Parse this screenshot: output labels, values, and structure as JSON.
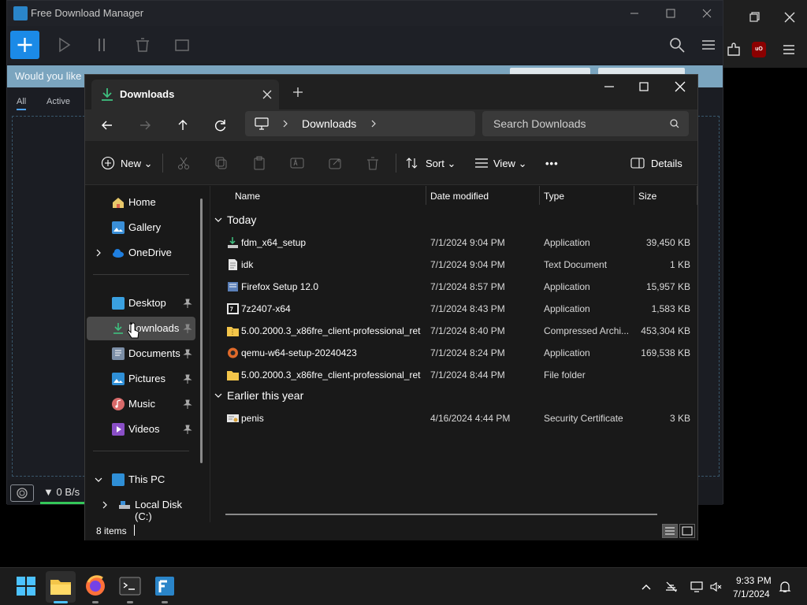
{
  "fdm": {
    "title": "Free Download Manager",
    "banner_text": "Would you like",
    "tabs": [
      "All",
      "Active"
    ],
    "speed": "0 B/s"
  },
  "explorer": {
    "tab_title": "Downloads",
    "address": "Downloads",
    "search_placeholder": "Search Downloads",
    "cmd": {
      "new_label": "New",
      "sort_label": "Sort",
      "view_label": "View",
      "more_label": "•••",
      "details_label": "Details"
    },
    "nav": {
      "home": "Home",
      "gallery": "Gallery",
      "onedrive": "OneDrive",
      "desktop": "Desktop",
      "downloads": "Downloads",
      "documents": "Documents",
      "pictures": "Pictures",
      "music": "Music",
      "videos": "Videos",
      "this_pc": "This PC",
      "local_disk": "Local Disk (C:)"
    },
    "columns": {
      "name": "Name",
      "date": "Date modified",
      "type": "Type",
      "size": "Size"
    },
    "groups": {
      "today": "Today",
      "earlier": "Earlier this year"
    },
    "files_today": [
      {
        "name": "fdm_x64_setup",
        "date": "7/1/2024 9:04 PM",
        "type": "Application",
        "size": "39,450 KB",
        "icon": "installer-icon"
      },
      {
        "name": "idk",
        "date": "7/1/2024 9:04 PM",
        "type": "Text Document",
        "size": "1 KB",
        "icon": "text-file-icon"
      },
      {
        "name": "Firefox Setup 12.0",
        "date": "7/1/2024 8:57 PM",
        "type": "Application",
        "size": "15,957 KB",
        "icon": "installer-icon"
      },
      {
        "name": "7z2407-x64",
        "date": "7/1/2024 8:43 PM",
        "type": "Application",
        "size": "1,583 KB",
        "icon": "7zip-icon"
      },
      {
        "name": "5.00.2000.3_x86fre_client-professional_ret...",
        "date": "7/1/2024 8:40 PM",
        "type": "Compressed Archi...",
        "size": "453,304 KB",
        "icon": "zip-folder-icon"
      },
      {
        "name": "qemu-w64-setup-20240423",
        "date": "7/1/2024 8:24 PM",
        "type": "Application",
        "size": "169,538 KB",
        "icon": "qemu-icon"
      },
      {
        "name": "5.00.2000.3_x86fre_client-professional_ret...",
        "date": "7/1/2024 8:44 PM",
        "type": "File folder",
        "size": "",
        "icon": "folder-icon"
      }
    ],
    "files_earlier": [
      {
        "name": "penis",
        "date": "4/16/2024 4:44 PM",
        "type": "Security Certificate",
        "size": "3 KB",
        "icon": "certificate-icon"
      }
    ],
    "status_count": "8 items"
  },
  "taskbar": {
    "time": "9:33 PM",
    "date": "7/1/2024"
  },
  "colors": {
    "accent": "#1b8ae7",
    "folder": "#f3c54a",
    "selection": "#4a4a4a"
  }
}
